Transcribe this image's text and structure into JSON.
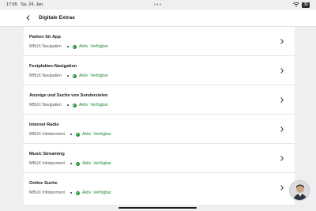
{
  "status_bar": {
    "time": "17:55",
    "date": "Sa. 24. Jan",
    "center_dots": "•••",
    "battery": "36"
  },
  "nav": {
    "title": "Digitale Extras"
  },
  "list": {
    "items": [
      {
        "title": "Parken für App",
        "category": "MBUX Navigation",
        "status": "Aktiv",
        "availability": "Verfügbar"
      },
      {
        "title": "Festplatten-Navigation",
        "category": "MBUX Navigation",
        "status": "Aktiv",
        "availability": "Verfügbar"
      },
      {
        "title": "Anzeige und Suche von Sonderzielen",
        "category": "MBUX Navigation",
        "status": "Aktiv",
        "availability": "Verfügbar"
      },
      {
        "title": "Internet Radio",
        "category": "MBUX Infotainment",
        "status": "Aktiv",
        "availability": "Verfügbar"
      },
      {
        "title": "Music Streaming",
        "category": "MBUX Infotainment",
        "status": "Aktiv",
        "availability": "Verfügbar"
      },
      {
        "title": "Online Suche",
        "category": "MBUX Infotainment",
        "status": "Aktiv",
        "availability": "Verfügbar"
      }
    ]
  },
  "colors": {
    "active_green": "#1f8a36",
    "background": "#efeff1"
  },
  "icons": {
    "back": "chevron-left-icon",
    "row": "chevron-right-icon",
    "status": "check-circle-icon",
    "wifi": "wifi-icon",
    "battery": "battery-icon"
  }
}
